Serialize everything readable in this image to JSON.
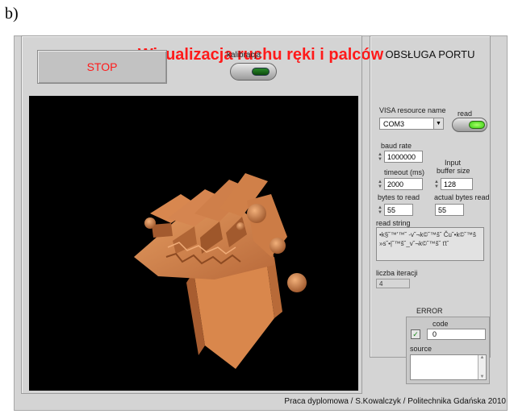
{
  "figure_label": "b)",
  "app": {
    "title": "Wizualizacja ruchu ręki i palców",
    "footer": "Praca dyplomowa / S.Kowalczyk / Politechnika Gdańska 2010"
  },
  "controls": {
    "stop_label": "STOP",
    "kalibracja_label": "kalibracja"
  },
  "port": {
    "title": "OBSŁUGA PORTU",
    "visa_label": "VISA resource name",
    "visa_value": "COM3",
    "read_label": "read",
    "baud_label": "baud rate",
    "baud_value": "1000000",
    "timeout_label": "timeout (ms)",
    "timeout_value": "2000",
    "input_buffer_label_1": "Input",
    "input_buffer_label_2": "buffer size",
    "input_buffer_value": "128",
    "bytes_to_read_label": "bytes to read",
    "bytes_to_read_value": "55",
    "actual_bytes_label": "actual bytes read",
    "actual_bytes_value": "55",
    "read_string_label": "read string",
    "read_string_value": "•k§˘™'™˘ -v˘¬k©˘™š˘ Ču˘•k©˘™š »s˘•|˘™š˘_v˘¬k©˘™š˘ ťt˘",
    "iter_label": "liczba iteracji",
    "iter_value": "4"
  },
  "error": {
    "title": "ERROR",
    "code_label": "code",
    "code_value": "0",
    "source_label": "source"
  },
  "colors": {
    "title_red": "#ff1a1a",
    "panel_gray": "#d4d4d4",
    "hand_orange": "#d8874f"
  }
}
